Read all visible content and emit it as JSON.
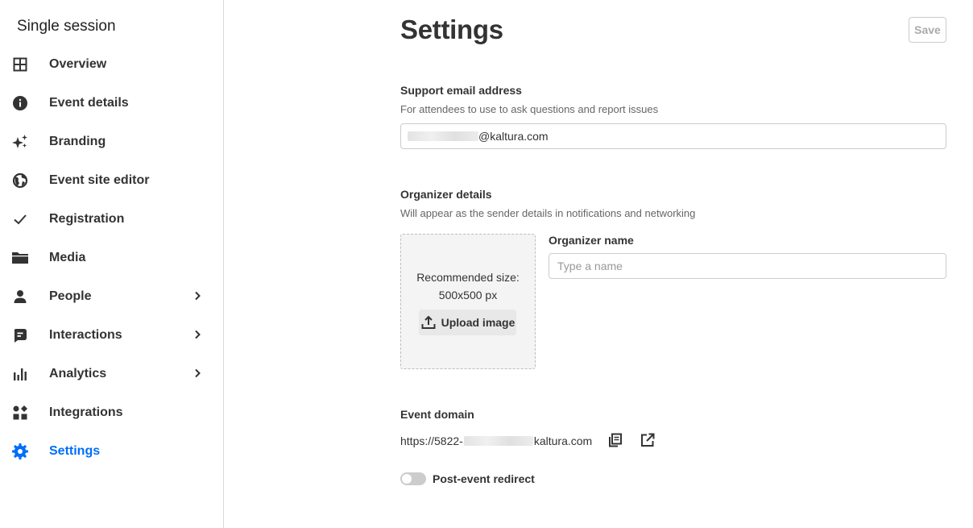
{
  "sidebar": {
    "title": "Single session",
    "items": [
      {
        "label": "Overview",
        "icon": "grid-icon",
        "has_submenu": false
      },
      {
        "label": "Event details",
        "icon": "info-icon",
        "has_submenu": false
      },
      {
        "label": "Branding",
        "icon": "sparkles-icon",
        "has_submenu": false
      },
      {
        "label": "Event site editor",
        "icon": "globe-icon",
        "has_submenu": false
      },
      {
        "label": "Registration",
        "icon": "check-icon",
        "has_submenu": false
      },
      {
        "label": "Media",
        "icon": "folder-icon",
        "has_submenu": false
      },
      {
        "label": "People",
        "icon": "person-icon",
        "has_submenu": true
      },
      {
        "label": "Interactions",
        "icon": "chat-icon",
        "has_submenu": true
      },
      {
        "label": "Analytics",
        "icon": "bar-chart-icon",
        "has_submenu": true
      },
      {
        "label": "Integrations",
        "icon": "shapes-icon",
        "has_submenu": false
      },
      {
        "label": "Settings",
        "icon": "gear-icon",
        "has_submenu": false,
        "active": true
      }
    ]
  },
  "header": {
    "title": "Settings",
    "save_label": "Save"
  },
  "support_email": {
    "label": "Support email address",
    "description": "For attendees to use to ask questions and report issues",
    "value_visible": "@kaltura.com"
  },
  "organizer": {
    "label": "Organizer details",
    "description": "Will appear as the sender details in notifications and networking",
    "upload_recommendation": "Recommended size: 500x500 px",
    "upload_button": "Upload image",
    "name_label": "Organizer name",
    "name_placeholder": "Type a name",
    "name_value": ""
  },
  "event_domain": {
    "label": "Event domain",
    "prefix": "https://5822-",
    "suffix": "kaltura.com"
  },
  "post_event_redirect": {
    "label": "Post-event redirect",
    "enabled": false
  },
  "colors": {
    "accent": "#006efa",
    "text": "#333333",
    "muted": "#666666",
    "border": "#cccccc"
  }
}
